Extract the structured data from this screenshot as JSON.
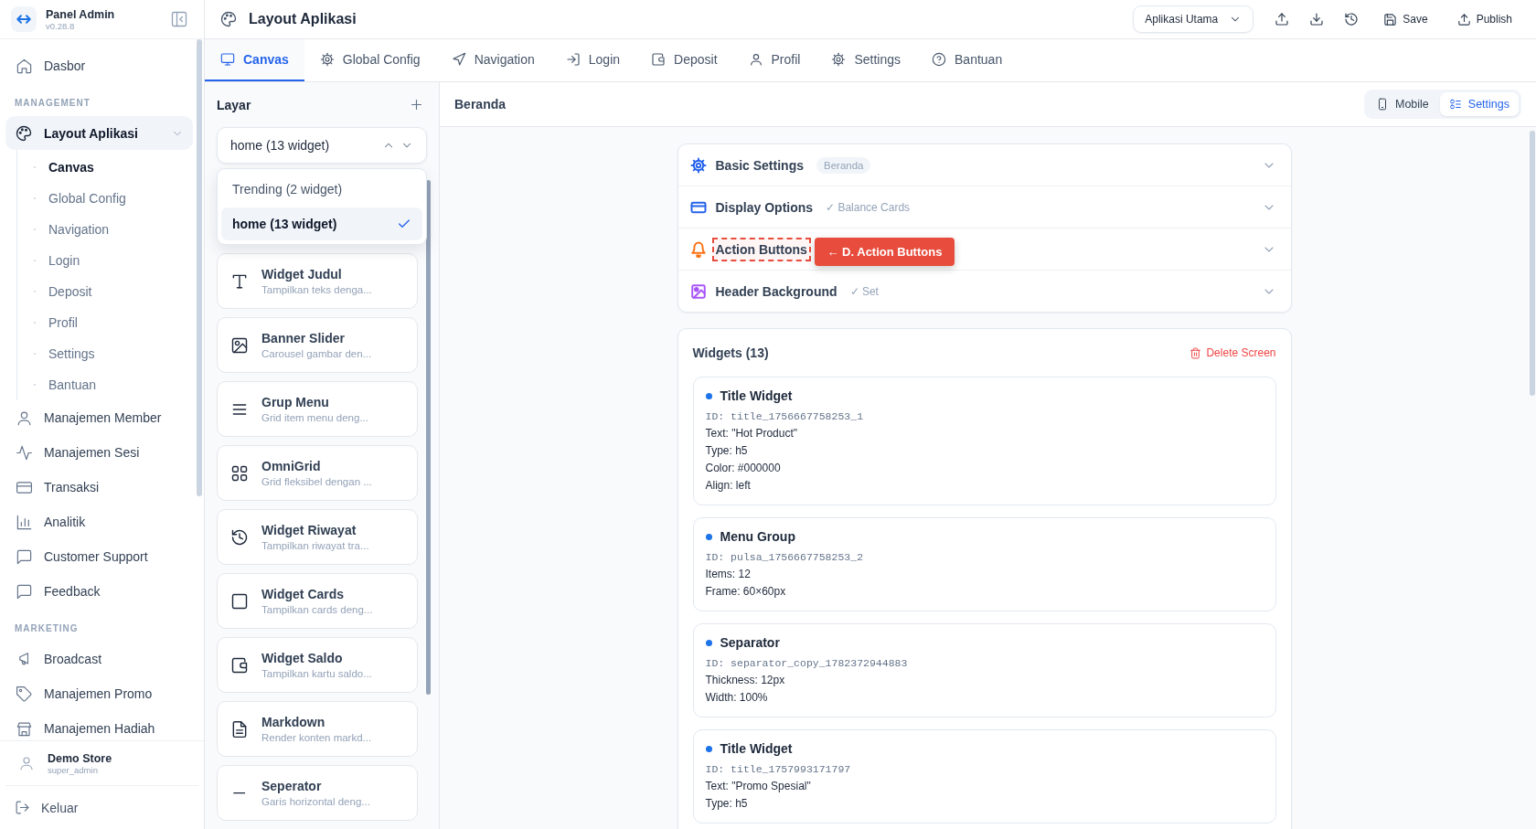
{
  "sidebar": {
    "brand": {
      "title": "Panel Admin",
      "version": "v0.28.8"
    },
    "nav": [
      {
        "kind": "item",
        "label": "Dasbor",
        "selected": false
      },
      {
        "kind": "heading",
        "label": "MANAGEMENT"
      },
      {
        "kind": "group",
        "label": "Layout Aplikasi",
        "selected": true,
        "expanded": true,
        "children": [
          {
            "label": "Canvas",
            "selected": true
          },
          {
            "label": "Global Config",
            "selected": false
          },
          {
            "label": "Navigation",
            "selected": false
          },
          {
            "label": "Login",
            "selected": false
          },
          {
            "label": "Deposit",
            "selected": false
          },
          {
            "label": "Profil",
            "selected": false
          },
          {
            "label": "Settings",
            "selected": false
          },
          {
            "label": "Bantuan",
            "selected": false
          }
        ]
      },
      {
        "kind": "item",
        "label": "Manajemen Member",
        "selected": false
      },
      {
        "kind": "item",
        "label": "Manajemen Sesi",
        "selected": false
      },
      {
        "kind": "item",
        "label": "Transaksi",
        "selected": false
      },
      {
        "kind": "item",
        "label": "Analitik",
        "selected": false
      },
      {
        "kind": "item",
        "label": "Customer Support",
        "selected": false
      },
      {
        "kind": "item",
        "label": "Feedback",
        "selected": false
      },
      {
        "kind": "heading",
        "label": "MARKETING"
      },
      {
        "kind": "item",
        "label": "Broadcast",
        "selected": false
      },
      {
        "kind": "item",
        "label": "Manajemen Promo",
        "selected": false
      },
      {
        "kind": "item",
        "label": "Manajemen Hadiah",
        "selected": false
      }
    ],
    "user": {
      "name": "Demo Store",
      "role": "super_admin"
    },
    "logout": "Keluar"
  },
  "header": {
    "title": "Layout Aplikasi",
    "app_select": "Aplikasi Utama",
    "save": "Save",
    "publish": "Publish"
  },
  "tabs": [
    {
      "label": "Canvas",
      "selected": true
    },
    {
      "label": "Global Config",
      "selected": false
    },
    {
      "label": "Navigation",
      "selected": false
    },
    {
      "label": "Login",
      "selected": false
    },
    {
      "label": "Deposit",
      "selected": false
    },
    {
      "label": "Profil",
      "selected": false
    },
    {
      "label": "Settings",
      "selected": false
    },
    {
      "label": "Bantuan",
      "selected": false
    }
  ],
  "screens_panel": {
    "title": "Layar",
    "select_value": "home (13 widget)",
    "options": [
      {
        "label": "Trending (2 widget)",
        "selected": false
      },
      {
        "label": "home (13 widget)",
        "selected": true
      }
    ],
    "library": [
      {
        "title": "Widget Judul",
        "desc": "Tampilkan teks denga..."
      },
      {
        "title": "Banner Slider",
        "desc": "Carousel gambar den..."
      },
      {
        "title": "Grup Menu",
        "desc": "Grid item menu deng..."
      },
      {
        "title": "OmniGrid",
        "desc": "Grid fleksibel dengan ..."
      },
      {
        "title": "Widget Riwayat",
        "desc": "Tampilkan riwayat tra..."
      },
      {
        "title": "Widget Cards",
        "desc": "Tampilkan cards deng..."
      },
      {
        "title": "Widget Saldo",
        "desc": "Tampilkan kartu saldo..."
      },
      {
        "title": "Markdown",
        "desc": "Render konten markd..."
      },
      {
        "title": "Seperator",
        "desc": "Garis horizontal deng..."
      }
    ]
  },
  "canvas": {
    "breadcrumb": "Beranda",
    "view_toggle": [
      {
        "label": "Mobile",
        "selected": false
      },
      {
        "label": "Settings",
        "selected": true
      }
    ],
    "sections": [
      {
        "title": "Basic Settings",
        "color": "#2563eb",
        "badge": "Beranda",
        "highlighted": false
      },
      {
        "title": "Display Options",
        "color": "#2563eb",
        "note": "✓ Balance Cards",
        "highlighted": false
      },
      {
        "title": "Action Buttons",
        "color": "#f97316",
        "highlighted": true
      },
      {
        "title": "Header Background",
        "color": "#a855f7",
        "note": "✓ Set",
        "highlighted": false
      }
    ],
    "callout": "← D. Action Buttons",
    "widgets_title": "Widgets (13)",
    "delete": "Delete Screen",
    "widgets": [
      {
        "name": "Title Widget",
        "id": "ID: title_1756667758253_1",
        "lines": [
          "Text: \"Hot Product\"",
          "Type: h5",
          "Color: #000000",
          "Align: left"
        ]
      },
      {
        "name": "Menu Group",
        "id": "ID: pulsa_1756667758253_2",
        "lines": [
          "Items: 12",
          "Frame: 60×60px"
        ]
      },
      {
        "name": "Separator",
        "id": "ID: separator_copy_1782372944883",
        "lines": [
          "Thickness: 12px",
          "Width: 100%"
        ]
      },
      {
        "name": "Title Widget",
        "id": "ID: title_1757993171797",
        "lines": [
          "Text: \"Promo Spesial\"",
          "Type: h5"
        ]
      }
    ]
  }
}
